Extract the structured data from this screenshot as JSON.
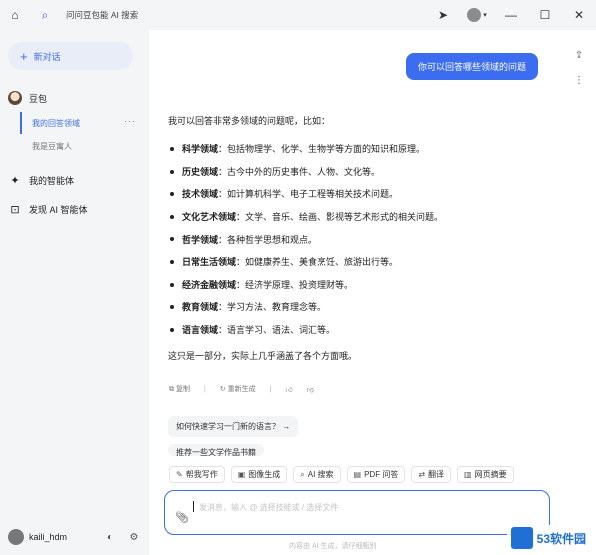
{
  "window": {
    "title": "问问豆包能 AI 搜索"
  },
  "sidebar": {
    "new_chat": "新对话",
    "doubao": "豆包",
    "sub_items": [
      "我的回答领域",
      "我是豆寓人"
    ],
    "dots": "···",
    "smart_agents": "我的智能体",
    "discover": "发现 AI 智能体",
    "user": "kaili_hdm"
  },
  "chat": {
    "question": "你可以回答哪些领域的问题",
    "intro": "我可以回答非常多领域的问题呢，比如：",
    "domains": [
      {
        "name": "科学领域",
        "desc": "：包括物理学、化学、生物学等方面的知识和原理。"
      },
      {
        "name": "历史领域",
        "desc": "：古今中外的历史事件、人物、文化等。"
      },
      {
        "name": "技术领域",
        "desc": "：如计算机科学、电子工程等相关技术问题。"
      },
      {
        "name": "文化艺术领域",
        "desc": "：文学、音乐、绘画、影视等艺术形式的相关问题。"
      },
      {
        "name": "哲学领域",
        "desc": "：各种哲学思想和观点。"
      },
      {
        "name": "日常生活领域",
        "desc": "：如健康养生、美食烹饪、旅游出行等。"
      },
      {
        "name": "经济金融领域",
        "desc": "：经济学原理、投资理财等。"
      },
      {
        "name": "教育领域",
        "desc": "：学习方法、教育理念等。"
      },
      {
        "name": "语言领域",
        "desc": "：语言学习、语法、词汇等。"
      }
    ],
    "outro": "这只是一部分，实际上几乎涵盖了各个方面哦。",
    "actions": {
      "copy": "复制",
      "regen": "重新生成"
    },
    "suggestions": [
      "如何快速学习一门新的语言？ →",
      "推荐一些文学作品书籍"
    ]
  },
  "toolbar": [
    {
      "icon": "✎",
      "label": "帮我写作"
    },
    {
      "icon": "▣",
      "label": "图像生成"
    },
    {
      "icon": "⌕",
      "label": "AI 搜索"
    },
    {
      "icon": "▤",
      "label": "PDF 问答"
    },
    {
      "icon": "⇄",
      "label": "翻译"
    },
    {
      "icon": "▥",
      "label": "网页摘要"
    }
  ],
  "input": {
    "placeholder": "发消息，输入 @ 选择技能或 / 选择文件"
  },
  "footer": "内容由 AI 生成，请仔细甄别",
  "watermark": "53软件园",
  "colors": {
    "accent": "#3c6df0"
  }
}
